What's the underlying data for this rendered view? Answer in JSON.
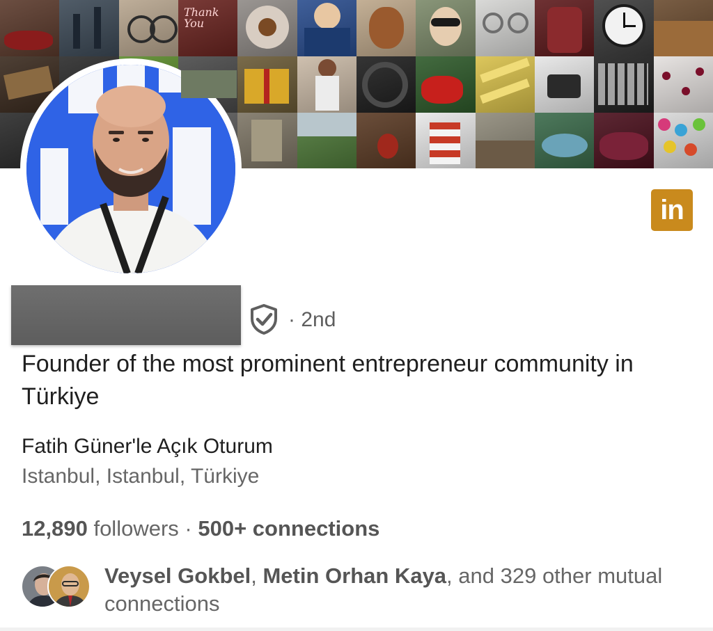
{
  "banner": {
    "tile_label": "Thank You"
  },
  "badge": {
    "text": "in",
    "color": "#c98a1d"
  },
  "profile": {
    "degree": "· 2nd",
    "verified_icon": "shield-check-icon",
    "headline": "Founder of the most prominent entrepreneur community in Türkiye",
    "company": "Fatih Güner'le Açık Oturum",
    "location": "Istanbul, Istanbul, Türkiye"
  },
  "stats": {
    "followers_count": "12,890",
    "followers_label": "followers",
    "separator": "·",
    "connections": "500+ connections"
  },
  "mutual": {
    "name_1": "Veysel Gokbel",
    "comma": ",",
    "name_2": "Metin Orhan Kaya",
    "rest": ", and 329 other mutual connections"
  }
}
